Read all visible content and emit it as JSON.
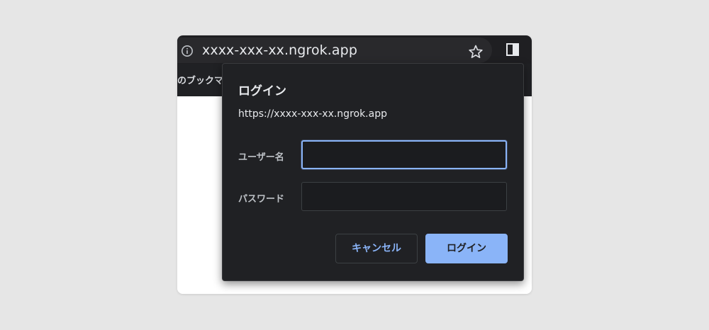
{
  "browser": {
    "url": "xxxx-xxx-xx.ngrok.app",
    "bookmarks_bar_label": "のブックマ",
    "icons": {
      "info": "info-icon",
      "bookmark_star": "star-icon",
      "side_panel": "side-panel-icon"
    }
  },
  "dialog": {
    "title": "ログイン",
    "origin": "https://xxxx-xxx-xx.ngrok.app",
    "username_label": "ユーザー名",
    "username_value": "",
    "password_label": "パスワード",
    "password_value": "",
    "cancel_label": "キャンセル",
    "login_label": "ログイン"
  },
  "colors": {
    "accent": "#8ab4f8",
    "dialog_bg": "#202124",
    "toolbar_bg": "#1f1f22",
    "backdrop": "#e6e6e6"
  }
}
